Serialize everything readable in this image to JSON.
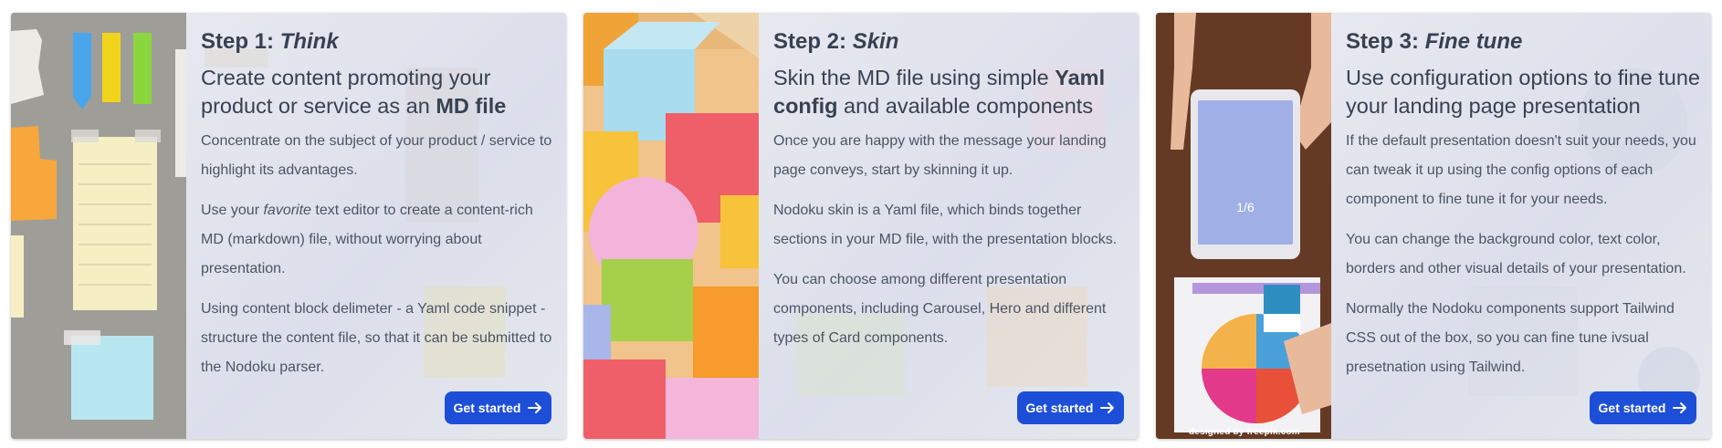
{
  "cards": [
    {
      "step_prefix": "Step 1:",
      "step_name": "Think",
      "headline_parts": [
        "Create content promoting your product or service as an ",
        "MD file",
        ""
      ],
      "paragraphs": [
        [
          "Concentrate on the subject of your product / service to highlight its advantages.",
          "",
          ""
        ],
        [
          "Use your ",
          "favorite",
          " text editor to create a content-rich MD (markdown) file, without worrying about presentation."
        ],
        [
          "Using content block delimeter - a Yaml code snippet - structure the content file, so that it can be submitted to the Nodoku parser.",
          "",
          ""
        ]
      ],
      "cta_label": "Get started",
      "cta_icon": "arrow-right-icon"
    },
    {
      "step_prefix": "Step 2:",
      "step_name": "Skin",
      "headline_parts": [
        "Skin the MD file using simple ",
        "Yaml config",
        " and available components"
      ],
      "paragraphs": [
        [
          "Once you are happy with the message your landing page conveys, start by skinning it up.",
          "",
          ""
        ],
        [
          "Nodoku skin is a Yaml file, which binds together sections in your MD file, with the presentation blocks.",
          "",
          ""
        ],
        [
          "You can choose among different presentation components, including Carousel, Hero and different types of Card components.",
          "",
          ""
        ]
      ],
      "cta_label": "Get started",
      "cta_icon": "arrow-right-icon"
    },
    {
      "step_prefix": "Step 3:",
      "step_name": "Fine tune",
      "headline_parts": [
        "Use configuration options to fine tune your landing page presentation",
        "",
        ""
      ],
      "paragraphs": [
        [
          "If the default presentation doesn't suit your needs, you can tweak it up using the config options of each component to fine tune it for your needs.",
          "",
          ""
        ],
        [
          "You can change the background color, text color, borders and other visual details of your presentation.",
          "",
          ""
        ],
        [
          "Normally the Nodoku components support Tailwind CSS out of the box, so you can fine tune ivsual presetnation using Tailwind.",
          "",
          ""
        ]
      ],
      "cta_label": "Get started",
      "cta_icon": "arrow-right-icon",
      "image_credit": "designed by freepik.com"
    }
  ],
  "colors": {
    "cta_background": "#1d4ed8",
    "card_background": "#e4e6ef"
  }
}
